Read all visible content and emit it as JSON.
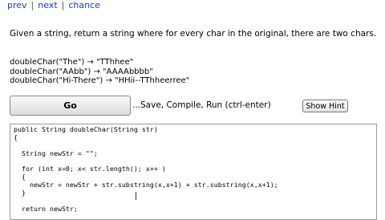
{
  "nav": {
    "prev": "prev",
    "separator": "|",
    "next": "next",
    "chance": "chance"
  },
  "description": "Given a string, return a string where for every char in the original, there are two chars.",
  "examples": [
    "doubleChar(\"The\") → \"TThhee\"",
    "doubleChar(\"AAbb\") → \"AAAAbbbb\"",
    "doubleChar(\"Hi-There\") → \"HHii--TThheerree\""
  ],
  "actions": {
    "go_label": "Go",
    "run_label": "...Save, Compile, Run (ctrl-enter)",
    "hint_label": "Show Hint"
  },
  "code": {
    "lines": [
      "public String doubleChar(String str)",
      "{",
      "",
      "  String newStr = \"\";",
      "",
      "  for (int x=0; x< str.length(); x++ )",
      "  {",
      "    newStr = newStr + str.substring(x,x+1) + str.substring(x,x+1);",
      "  }",
      "",
      "  return newStr;"
    ]
  },
  "colors": {
    "link": "#1a3cc7",
    "keyword": "#7f0055"
  }
}
